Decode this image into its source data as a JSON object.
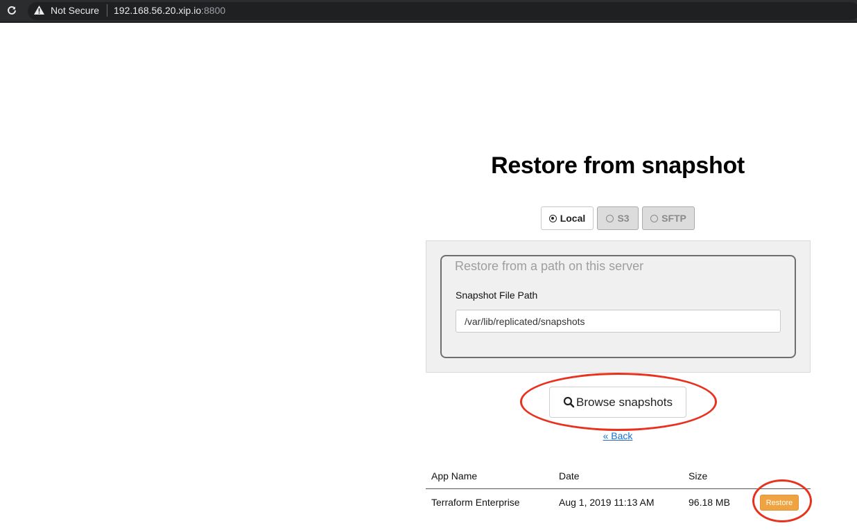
{
  "browser": {
    "not_secure_label": "Not Secure",
    "url_host": "192.168.56.20.xip.io",
    "url_port": ":8800"
  },
  "page": {
    "title": "Restore from snapshot"
  },
  "source_tabs": [
    {
      "label": "Local",
      "selected": true
    },
    {
      "label": "S3",
      "selected": false
    },
    {
      "label": "SFTP",
      "selected": false
    }
  ],
  "form": {
    "legend": "Restore from a path on this server",
    "path_label": "Snapshot File Path",
    "path_value": "/var/lib/replicated/snapshots"
  },
  "actions": {
    "browse_label": "Browse snapshots",
    "back_label": "« Back"
  },
  "table": {
    "headers": [
      "App Name",
      "Date",
      "Size"
    ],
    "rows": [
      {
        "app_name": "Terraform Enterprise",
        "date": "Aug 1, 2019 11:13 AM",
        "size": "96.18 MB",
        "action_label": "Restore"
      }
    ]
  },
  "colors": {
    "highlight": "#e8321e",
    "restore_button": "#f0a341",
    "link": "#1a6fd1"
  }
}
